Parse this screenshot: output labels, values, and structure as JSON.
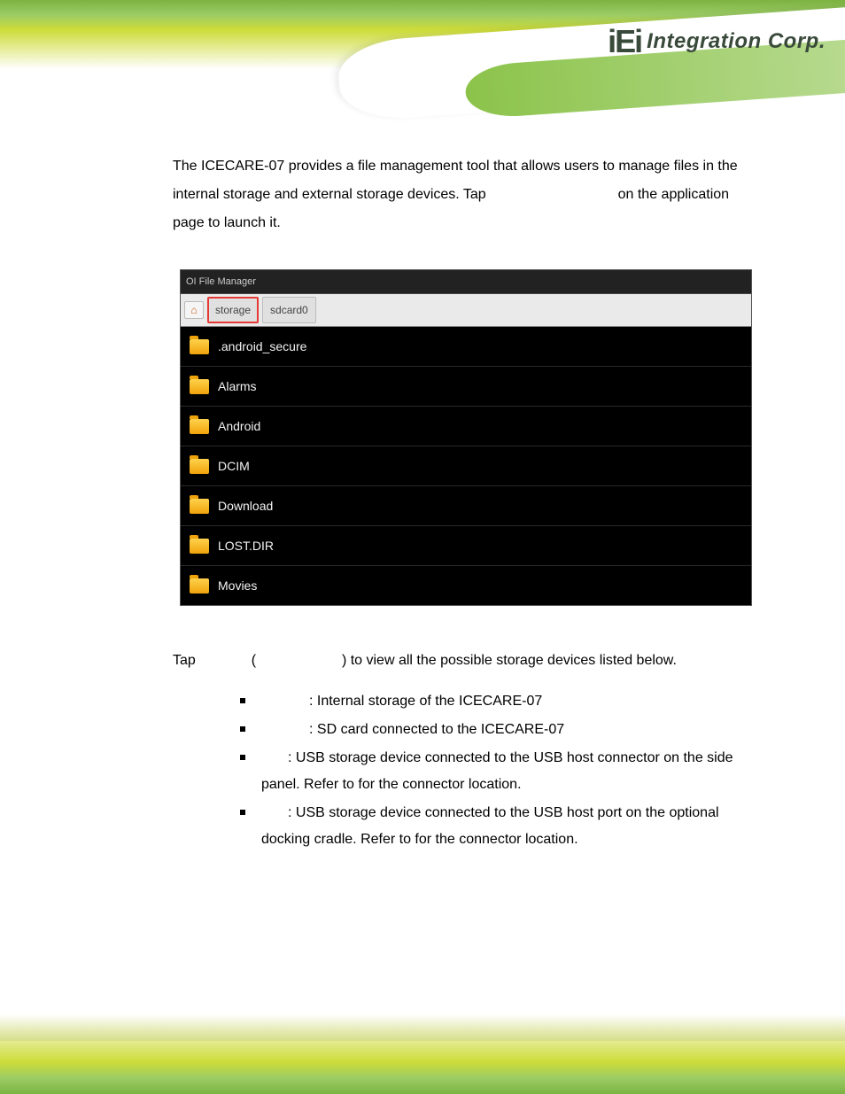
{
  "brand": {
    "logoShort": "iEi",
    "logoLong": "Integration Corp."
  },
  "intro": {
    "line1": "The ICECARE-07 provides a file management tool that allows users to manage files in the",
    "line2a": "internal storage and external storage devices. Tap",
    "line2b": "on the application",
    "line3": "page to launch it."
  },
  "screenshot": {
    "title": "OI File Manager",
    "breadcrumb": {
      "activeChip": "storage",
      "otherChip": "sdcard0"
    },
    "rows": [
      ".android_secure",
      "Alarms",
      "Android",
      "DCIM",
      "Download",
      "LOST.DIR",
      "Movies"
    ]
  },
  "tapline": {
    "a": "Tap",
    "b": "(",
    "c": ") to view all the possible storage devices listed below."
  },
  "devices": [
    {
      "text": ": Internal storage of the ICECARE-07"
    },
    {
      "text": ": SD card connected to the ICECARE-07"
    },
    {
      "text": ": USB storage device connected to the USB host connector on the side",
      "cont": "panel. Refer to                     for the connector location."
    },
    {
      "text": ": USB storage device connected to the USB host port on the optional",
      "cont": "docking cradle. Refer to                        for the connector location."
    }
  ]
}
